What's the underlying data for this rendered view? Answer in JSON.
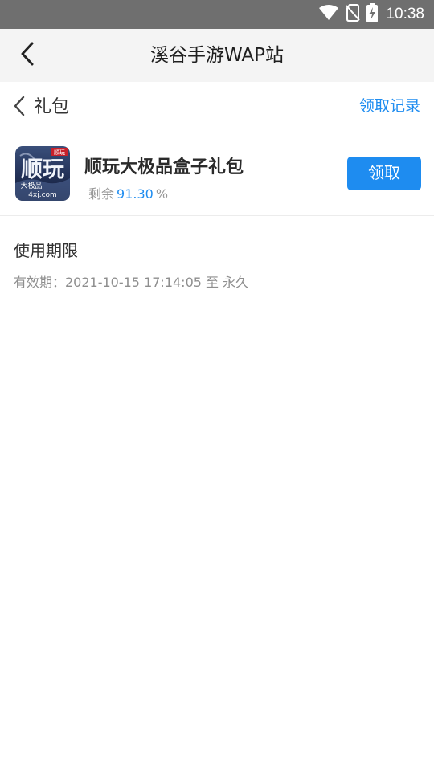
{
  "status_bar": {
    "time": "10:38",
    "icons": [
      "wifi-icon",
      "no-sim-icon",
      "battery-charging-icon"
    ]
  },
  "title_bar": {
    "title": "溪谷手游WAP站",
    "back_icon": "chevron-left-icon"
  },
  "section": {
    "title": "礼包",
    "back_icon": "chevron-left-icon",
    "records_link": "领取记录"
  },
  "gift": {
    "name": "顺玩大极品盒子礼包",
    "remain_label": "剩余",
    "remain_percent": "91.30",
    "percent_sign": "%",
    "claim_label": "领取",
    "icon_text": {
      "main": "顺玩",
      "badge": "顺玩",
      "sub": "大极品",
      "site": "4xj.com"
    }
  },
  "validity": {
    "title": "使用期限",
    "text": "有效期：2021-10-15 17:14:05 至 永久"
  },
  "colors": {
    "accent": "#1e8cf0",
    "status_bar": "#6f6f6f",
    "title_bar_bg": "#f4f4f4"
  }
}
